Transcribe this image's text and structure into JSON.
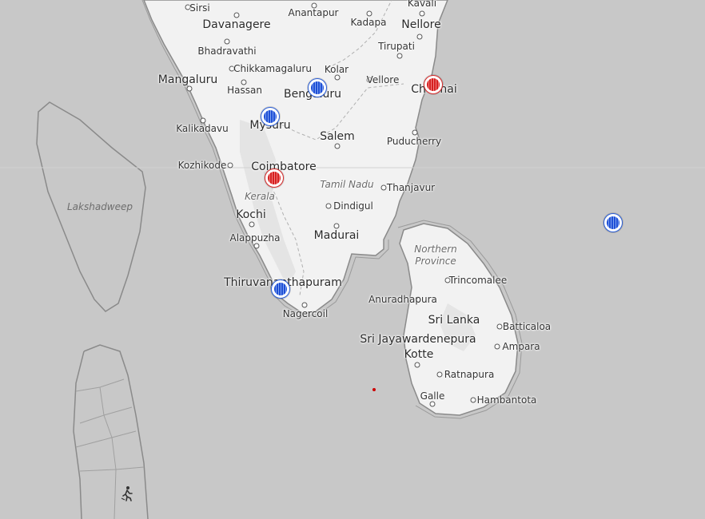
{
  "map": {
    "labels": [
      {
        "id": "sirsi",
        "text": "Sirsi"
      },
      {
        "id": "davanagere",
        "text": "Davanagere"
      },
      {
        "id": "anantapur",
        "text": "Anantapur"
      },
      {
        "id": "kavali",
        "text": "Kavali"
      },
      {
        "id": "kadapa",
        "text": "Kadapa"
      },
      {
        "id": "nellore",
        "text": "Nellore"
      },
      {
        "id": "bhadravathi",
        "text": "Bhadravathi"
      },
      {
        "id": "tirupati",
        "text": "Tirupati"
      },
      {
        "id": "chikkamagaluru",
        "text": "Chikkamagaluru"
      },
      {
        "id": "kolar",
        "text": "Kolar"
      },
      {
        "id": "mangaluru",
        "text": "Mangaluru"
      },
      {
        "id": "hassan",
        "text": "Hassan"
      },
      {
        "id": "vellore",
        "text": "Vellore"
      },
      {
        "id": "bengaluru",
        "text": "Bengaluru"
      },
      {
        "id": "chennai",
        "text": "Chennai"
      },
      {
        "id": "kalikadavu",
        "text": "Kalikadavu"
      },
      {
        "id": "mysuru",
        "text": "Mysuru"
      },
      {
        "id": "salem",
        "text": "Salem"
      },
      {
        "id": "puducherry",
        "text": "Puducherry"
      },
      {
        "id": "kozhikode",
        "text": "Kozhikode"
      },
      {
        "id": "coimbatore",
        "text": "Coimbatore"
      },
      {
        "id": "tamilnadu",
        "text": "Tamil Nadu"
      },
      {
        "id": "thanjavur",
        "text": "Thanjavur"
      },
      {
        "id": "kerala",
        "text": "Kerala"
      },
      {
        "id": "lakshadweep",
        "text": "Lakshadweep"
      },
      {
        "id": "dindigul",
        "text": "Dindigul"
      },
      {
        "id": "kochi",
        "text": "Kochi"
      },
      {
        "id": "alappuzha",
        "text": "Alappuzha"
      },
      {
        "id": "madurai",
        "text": "Madurai"
      },
      {
        "id": "northernprovince",
        "text": "Northern Province"
      },
      {
        "id": "trincomalee",
        "text": "Trincomalee"
      },
      {
        "id": "thiruvananthapuram",
        "text": "Thiruvananthapuram"
      },
      {
        "id": "anuradhapura",
        "text": "Anuradhapura"
      },
      {
        "id": "nagercoil",
        "text": "Nagercoil"
      },
      {
        "id": "srilanka",
        "text": "Sri Lanka"
      },
      {
        "id": "batticaloa",
        "text": "Batticaloa"
      },
      {
        "id": "srijayawardenepura",
        "text": "Sri Jayawardenepura"
      },
      {
        "id": "kotte",
        "text": "Kotte"
      },
      {
        "id": "ampara",
        "text": "Ampara"
      },
      {
        "id": "ratnapura",
        "text": "Ratnapura"
      },
      {
        "id": "galle",
        "text": "Galle"
      },
      {
        "id": "hambantota",
        "text": "Hambantota"
      }
    ],
    "markers": [
      {
        "id": "marker-bengaluru",
        "color": "#1f4fd6"
      },
      {
        "id": "marker-mysuru",
        "color": "#1f4fd6"
      },
      {
        "id": "marker-chennai",
        "color": "#d62020"
      },
      {
        "id": "marker-coimbatore",
        "color": "#d62020"
      },
      {
        "id": "marker-thiruvananthapuram",
        "color": "#1f4fd6"
      },
      {
        "id": "marker-ocean",
        "color": "#1f4fd6"
      }
    ],
    "colors": {
      "sea": "#c8c8c8",
      "land": "#f2f2f2",
      "border": "#8a8a8a",
      "red_dot": "#cc0000"
    },
    "icons": [
      "hiker-icon"
    ]
  }
}
